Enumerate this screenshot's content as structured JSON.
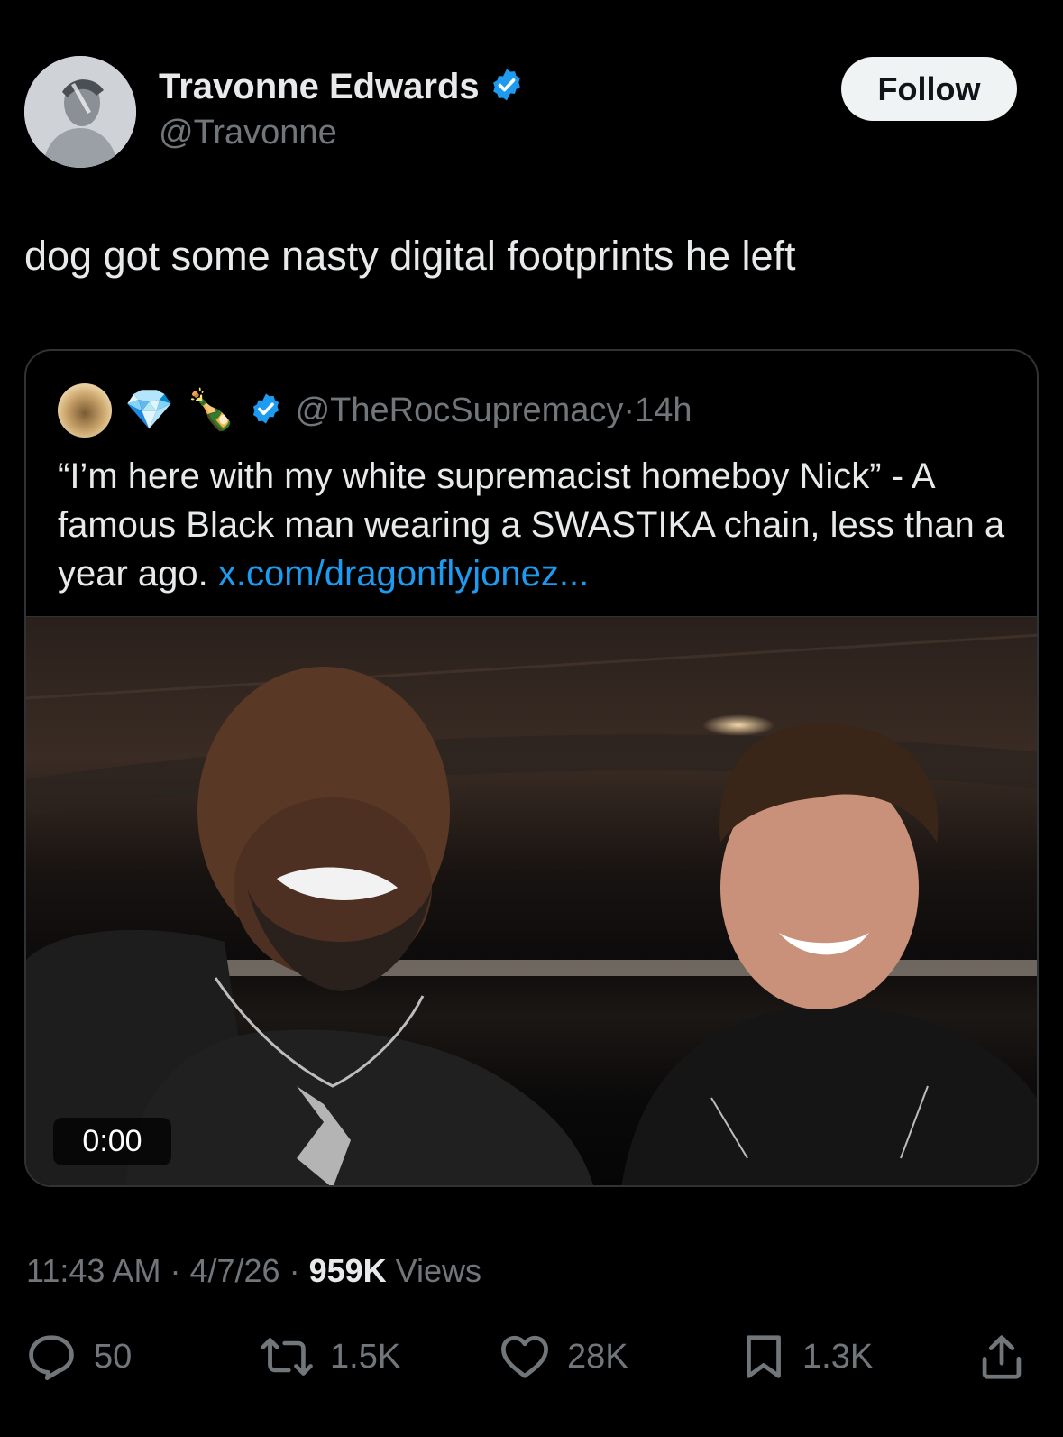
{
  "author": {
    "display_name": "Travonne Edwards",
    "handle": "@Travonne",
    "verified_icon": "verified-badge-icon"
  },
  "follow_label": "Follow",
  "tweet": {
    "text": "dog got some nasty digital footprints he left"
  },
  "quoted": {
    "emojis": [
      "💎",
      "🍾"
    ],
    "handle": "@TheRocSupremacy",
    "separator": "·",
    "age": "14h",
    "text": "“I’m here with my white supremacist homeboy Nick” - A famous Black man wearing a SWASTIKA chain, less than a year ago.",
    "link": "x.com/dragonflyjonez...",
    "video_time": "0:00"
  },
  "meta": {
    "time": "11:43 AM",
    "dot": "·",
    "date": "4/7/26",
    "views_count": "959K",
    "views_label": "Views"
  },
  "actions": {
    "replies": "50",
    "reposts": "1.5K",
    "likes": "28K",
    "bookmarks": "1.3K"
  },
  "colors": {
    "background": "#000000",
    "text": "#e7e9ea",
    "muted": "#71767b",
    "link": "#1d9bf0",
    "verified": "#1d9bf0",
    "border": "#2f3336"
  }
}
